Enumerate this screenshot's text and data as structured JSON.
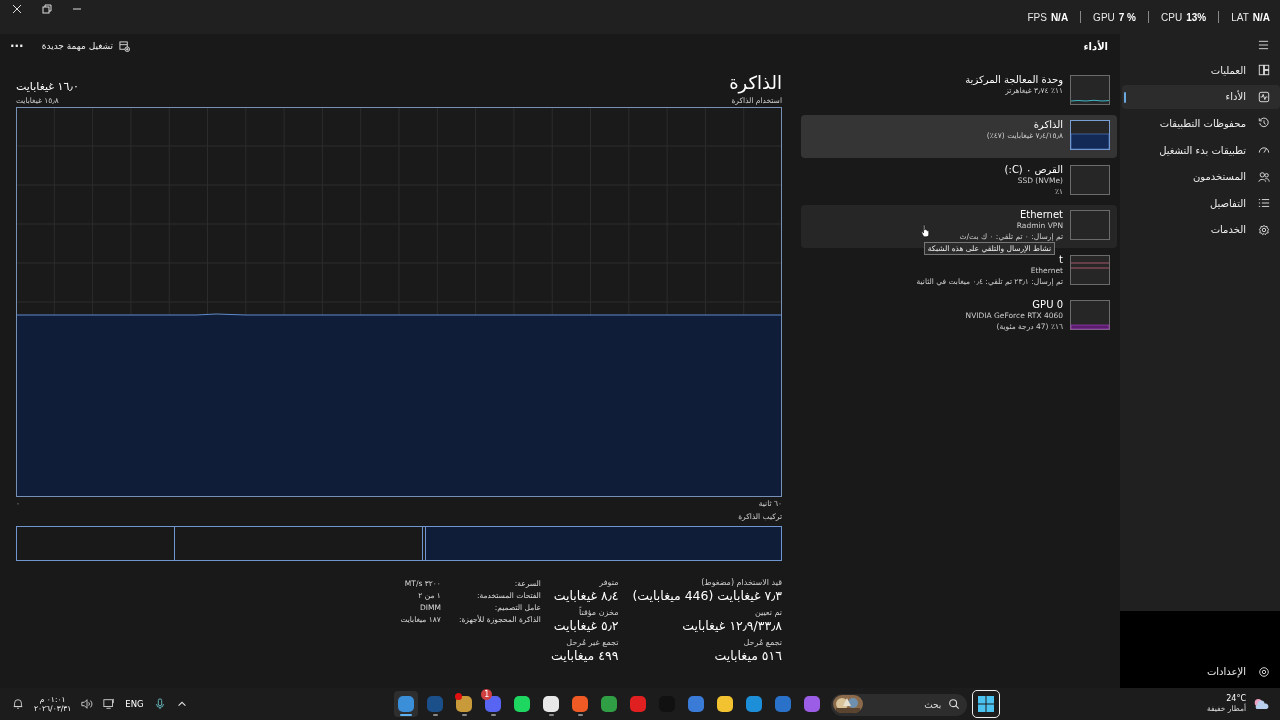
{
  "overlay": [
    {
      "label": "LAT",
      "value": "N/A"
    },
    {
      "label": "CPU",
      "value": "13%"
    },
    {
      "label": "GPU",
      "value": "7 %"
    },
    {
      "label": "FPS",
      "value": "N/A"
    }
  ],
  "header": {
    "title": "الأداء",
    "run_task": "تشغيل مهمة جديدة",
    "more": "···"
  },
  "nav": {
    "items": [
      {
        "label": "العمليات",
        "kind": "processes",
        "selected": false
      },
      {
        "label": "الأداء",
        "kind": "performance",
        "selected": true
      },
      {
        "label": "محفوظات التطبيقات",
        "kind": "history",
        "selected": false
      },
      {
        "label": "تطبيقات بدء التشغيل",
        "kind": "startup",
        "selected": false
      },
      {
        "label": "المستخدمون",
        "kind": "users",
        "selected": false
      },
      {
        "label": "التفاصيل",
        "kind": "details",
        "selected": false
      },
      {
        "label": "الخدمات",
        "kind": "services",
        "selected": false
      }
    ],
    "settings": "الإعدادات"
  },
  "devices": [
    {
      "title": "وحدة المعالجة المركزية",
      "lines": [
        "١١٪ ٣٫٧٤ غيغاهرتز"
      ],
      "kind": "cpu",
      "selected": false,
      "hovered": false
    },
    {
      "title": "الذاكرة",
      "lines": [
        "٧٫٤/١٥٫٨ غيغابايت (٤٧٪)"
      ],
      "kind": "memory",
      "selected": true,
      "hovered": false
    },
    {
      "title": "القرص ٠ (C:)",
      "lines": [
        "SSD (NVMe)",
        "١٪"
      ],
      "kind": "disk",
      "selected": false,
      "hovered": false
    },
    {
      "title": "Ethernet",
      "lines": [
        "Radmin VPN",
        "تم إرسال: ٠ تم تلقي: ٠ ك بت/ث"
      ],
      "kind": "network",
      "selected": false,
      "hovered": true
    },
    {
      "title": "t",
      "lines": [
        "Ethernet",
        "تم إرسال: ٢٣٫١ تم تلقي: ٠٫٤ ميغابت في الثانية"
      ],
      "kind": "traffic",
      "selected": false,
      "hovered": false,
      "tooltip": "نشاط الإرسال والتلقي على هذه الشبكة"
    },
    {
      "title": "GPU 0",
      "lines": [
        "NVIDIA GeForce RTX 4060",
        "١٦٪ (47 درجة مئوية)"
      ],
      "kind": "gpu",
      "selected": false,
      "hovered": false
    }
  ],
  "memory": {
    "title": "الذاكرة",
    "total": "١٦٫٠ غيغابايت",
    "subtitle": "استخدام الذاكرة",
    "max": "١٥٫٨ غيغابايت",
    "time_label": "٦٠ ثانية",
    "zero_label": "٠",
    "composition_title": "تركيب الذاكرة",
    "composition": [
      {
        "level": 0.466,
        "filled": true
      },
      {
        "level": 0.004,
        "filled": false
      },
      {
        "level": 0.325,
        "filled": false
      },
      {
        "level": 0.205,
        "filled": false
      }
    ],
    "stats": [
      {
        "label": "قيد الاستخدام (مضغوط)",
        "value": "٧٫٣ غيغابايت (446 ميغابايت)"
      },
      {
        "label": "تم تعيين",
        "value": "١٢٫٩/٣٣٫٨ غيغابايت"
      },
      {
        "label": "تجمع مُرحل",
        "value": "٥١٦ ميغابايت"
      },
      {
        "label": "متوفر",
        "value": "٨٫٤ غيغابايت"
      },
      {
        "label": "مخزن مؤقتاً",
        "value": "٥٫٢ غيغابايت"
      },
      {
        "label": "تجمع غير مُرحل",
        "value": "٤٩٩ ميغابايت"
      }
    ],
    "details": [
      {
        "label": "السرعة:",
        "value": "٣٢٠٠ MT/s"
      },
      {
        "label": "الفتحات المستخدمة:",
        "value": "١ من ٢"
      },
      {
        "label": "عامل التصميم:",
        "value": "DIMM"
      },
      {
        "label": "الذاكرة المحجوزة للأجهزة:",
        "value": "١٨٧ ميغابايت"
      }
    ]
  },
  "taskbar": {
    "time": "٠١:٠١ م",
    "date": "٢٠٢٦/٠٣/٣١",
    "language": "ENG",
    "apps": [
      {
        "color": "#3a8fd8",
        "running": true,
        "active": true
      },
      {
        "color": "#1b4f8a",
        "running": true,
        "active": false
      },
      {
        "color": "#c89a3a",
        "running": true,
        "active": false,
        "dot": true
      },
      {
        "color": "#5865f2",
        "running": true,
        "active": false,
        "badge": "1"
      },
      {
        "color": "#1ed760",
        "running": false,
        "active": false
      },
      {
        "color": "#e8e8e8",
        "running": true,
        "active": false
      },
      {
        "color": "#f05a24",
        "running": true,
        "active": false
      },
      {
        "color": "#2f9e44",
        "running": false,
        "active": false
      },
      {
        "color": "#e02020",
        "running": false,
        "active": false
      },
      {
        "color": "#111111",
        "running": false,
        "active": false
      },
      {
        "color": "#3b7bd8",
        "running": false,
        "active": false
      },
      {
        "color": "#f2c230",
        "running": false,
        "active": false
      },
      {
        "color": "#1c8fd8",
        "running": false,
        "active": false
      },
      {
        "color": "#2a72c9",
        "running": false,
        "active": false
      },
      {
        "color": "#9b5de5",
        "running": false,
        "active": false
      }
    ],
    "search_placeholder": "بحث",
    "temperature": "24°C",
    "weather": "أمطار خفيفة"
  }
}
